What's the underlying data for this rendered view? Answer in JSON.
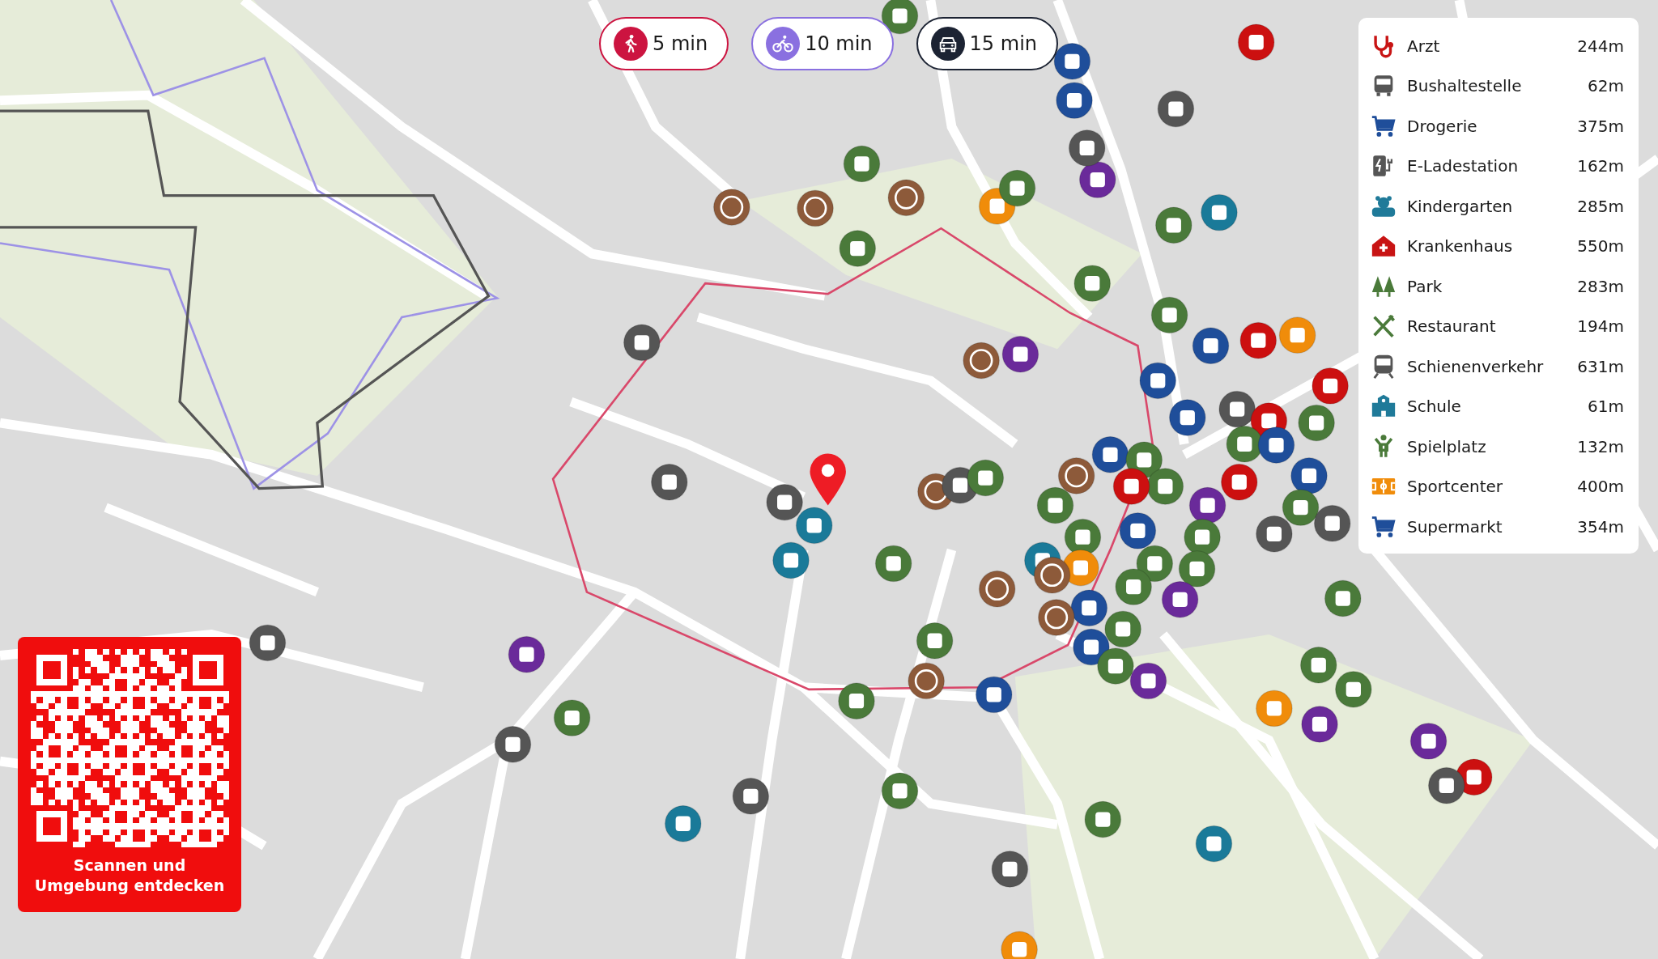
{
  "travel_modes": [
    {
      "kind": "walk",
      "label": "5 min",
      "color": "#cc1440"
    },
    {
      "kind": "bike",
      "label": "10 min",
      "color": "#8a70e0"
    },
    {
      "kind": "car",
      "label": "15 min",
      "color": "#1c2333"
    }
  ],
  "legend": {
    "items": [
      {
        "kind": "doctor",
        "label": "Arzt",
        "distance": "244m",
        "color": "#c81414"
      },
      {
        "kind": "bus",
        "label": "Bushaltestelle",
        "distance": "62m",
        "color": "#555555"
      },
      {
        "kind": "cart",
        "label": "Drogerie",
        "distance": "375m",
        "color": "#1f4e9a"
      },
      {
        "kind": "charger",
        "label": "E-Ladestation",
        "distance": "162m",
        "color": "#555555"
      },
      {
        "kind": "teddy",
        "label": "Kindergarten",
        "distance": "285m",
        "color": "#1f7a99"
      },
      {
        "kind": "hospital",
        "label": "Krankenhaus",
        "distance": "550m",
        "color": "#c81414"
      },
      {
        "kind": "trees",
        "label": "Park",
        "distance": "283m",
        "color": "#4a7a3a"
      },
      {
        "kind": "cutlery",
        "label": "Restaurant",
        "distance": "194m",
        "color": "#4a7a3a"
      },
      {
        "kind": "train",
        "label": "Schienenverkehr",
        "distance": "631m",
        "color": "#555555"
      },
      {
        "kind": "school",
        "label": "Schule",
        "distance": "61m",
        "color": "#1f7a99"
      },
      {
        "kind": "person",
        "label": "Spielplatz",
        "distance": "132m",
        "color": "#4a7a3a"
      },
      {
        "kind": "field",
        "label": "Sportcenter",
        "distance": "400m",
        "color": "#f08c0a"
      },
      {
        "kind": "cart",
        "label": "Supermarkt",
        "distance": "354m",
        "color": "#1f4e9a"
      }
    ]
  },
  "qr_card": {
    "caption": "Scannen und Umgebung entdecken"
  }
}
